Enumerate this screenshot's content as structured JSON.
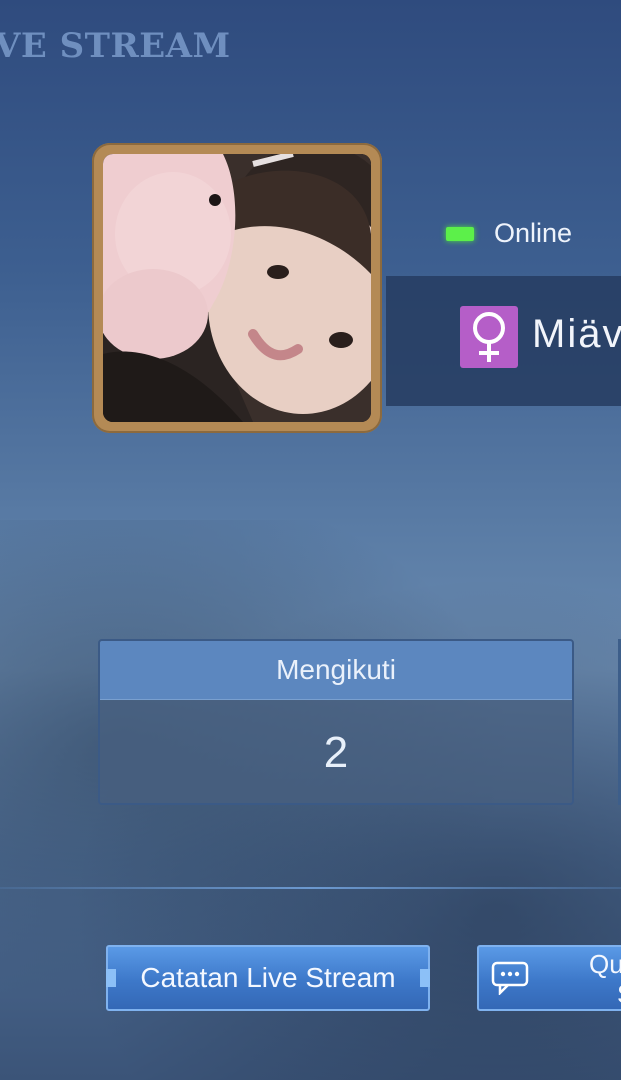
{
  "page": {
    "title": "VE STREAM"
  },
  "profile": {
    "status": "Online",
    "name": "Miäv",
    "gender_symbol": "♀"
  },
  "stats": [
    {
      "label": "Mengikuti",
      "value": "2"
    }
  ],
  "buttons": {
    "log_label": "Catatan Live Stream",
    "second_label_line1": "Qu",
    "second_label_line2": "S"
  },
  "colors": {
    "accent_blue": "#4a86d6",
    "online_green": "#5cf04a",
    "gender_female": "#b55ec8",
    "frame_gold": "#b48a55"
  },
  "icons": {
    "status": "online-indicator-icon",
    "gender": "female-icon",
    "chat": "chat-bubble-icon"
  }
}
